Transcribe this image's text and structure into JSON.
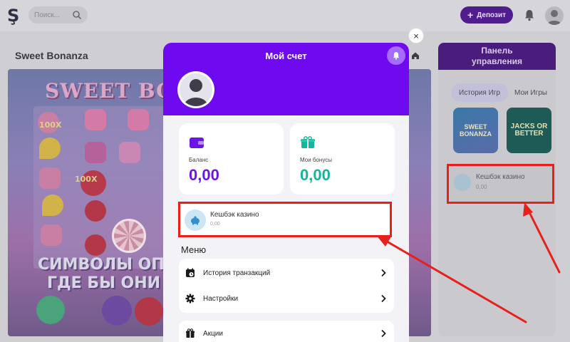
{
  "header": {
    "logo_text": "Ş",
    "search_placeholder": "Поиск...",
    "deposit_label": "Депозит",
    "deposit_plus": "+",
    "accent_color": "#4f1d8d"
  },
  "game": {
    "title": "Sweet Bonanza",
    "logo_text": "SWEET BONA",
    "multiplier_1": "100X",
    "multiplier_2": "100X",
    "line_1": "СИМВОЛЫ ОПЛАЧ",
    "line_2": "ГДЕ БЫ ОНИ НЕ"
  },
  "side_panel": {
    "title_line_1": "Панель",
    "title_line_2": "управления",
    "tabs": [
      {
        "label": "История Игр",
        "active": true
      },
      {
        "label": "Мои Игры",
        "active": false
      }
    ],
    "thumbs": [
      {
        "line_1": "SWEET",
        "line_2": "BONANZA"
      },
      {
        "line_1": "JACKS OR",
        "line_2": "BETTER"
      }
    ],
    "cashback": {
      "label": "Кешбэк казино",
      "value": "0,00"
    }
  },
  "modal": {
    "title": "Мой счет",
    "brand_color": "#6f0af0",
    "close_symbol": "×",
    "balance": {
      "label": "Баланс",
      "value": "0,00",
      "icon": "wallet-icon"
    },
    "bonuses": {
      "label": "Мои бонусы",
      "value": "0,00",
      "icon": "gift-icon"
    },
    "cashback": {
      "label": "Кешбэк казино",
      "value": "0,00",
      "icon": "piggy-bank-icon"
    },
    "menu_title": "Меню",
    "menu_items": [
      {
        "label": "История транзакций",
        "icon": "history-icon"
      },
      {
        "label": "Настройки",
        "icon": "gear-icon"
      },
      {
        "label": "Акции",
        "icon": "gift-icon"
      }
    ]
  },
  "annotation_color": "#e8201c"
}
